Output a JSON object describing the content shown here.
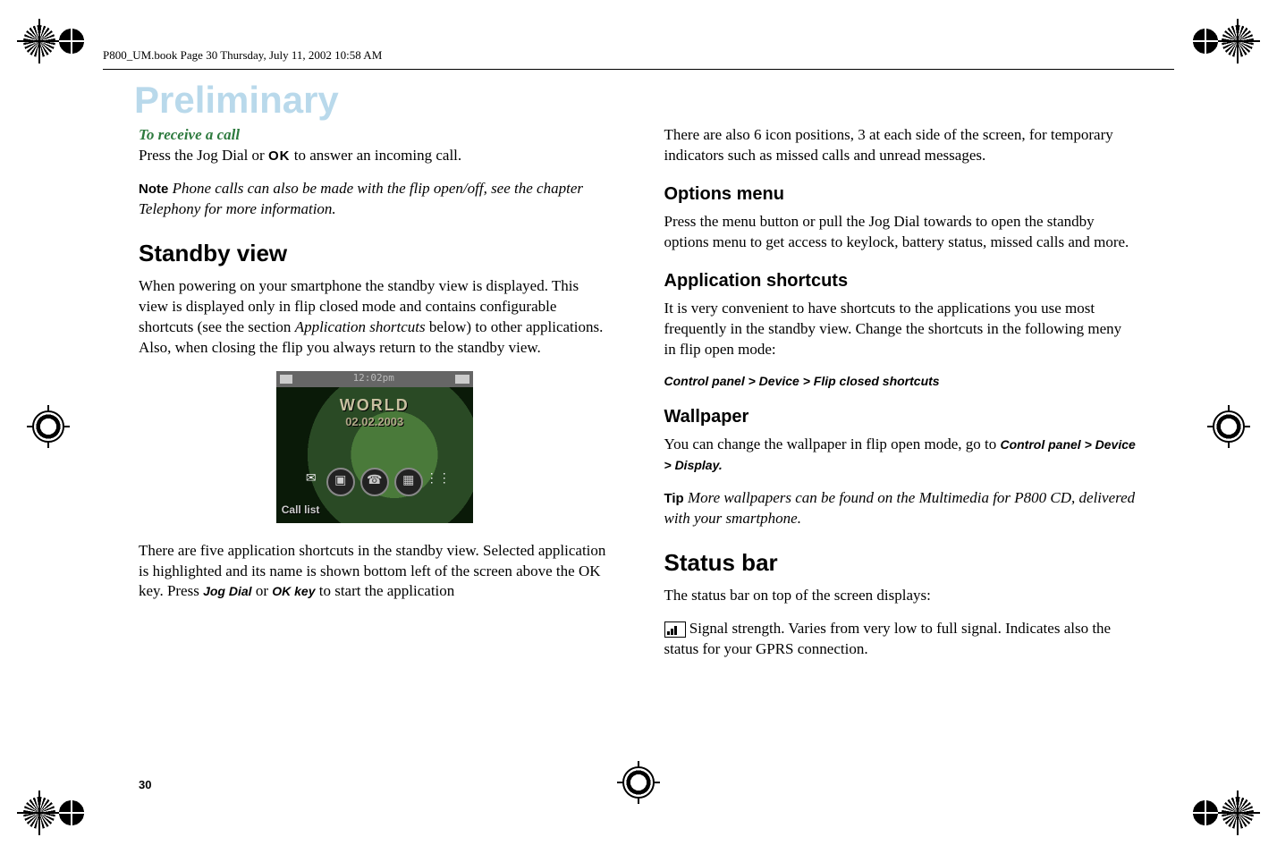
{
  "header": "P800_UM.book  Page 30  Thursday, July 11, 2002  10:58 AM",
  "watermark": "Preliminary",
  "page_number": "30",
  "left": {
    "receive_heading": "To receive a call",
    "receive_prefix": "Press the Jog Dial or ",
    "receive_ok": "OK",
    "receive_suffix": " to answer an incoming call.",
    "note_label": "Note",
    "note_body": " Phone calls can also be made with the flip open/off, see the chapter Telephony for more information.",
    "standby_heading": "Standby view",
    "standby_p1_a": "When powering on your smartphone the standby view is displayed. This view is displayed only in flip closed mode and contains configurable shortcuts (see the section ",
    "standby_p1_em": "Application shortcuts",
    "standby_p1_b": " below) to other applications. Also, when closing the flip you always return to the standby view.",
    "screenshot": {
      "time": "12:02pm",
      "label": "WORLD",
      "date": "02.02.2003",
      "bottom_label": "Call list"
    },
    "shortcuts_p_a": "There are five application shortcuts in the standby view. Selected application is highlighted and its name is shown bottom left of the screen above the OK key. Press ",
    "jog_dial": "Jog Dial",
    "or_word": " or ",
    "ok_key": "OK key",
    "shortcuts_p_c": " to start the application"
  },
  "right": {
    "intro": "There are also 6 icon positions, 3 at each side of the screen, for temporary indicators such as missed calls and unread messages.",
    "options_h": "Options menu",
    "options_p": "Press the menu button or pull the Jog Dial towards to open the standby options menu to get access to keylock, battery status, missed calls and more.",
    "app_h": "Application shortcuts",
    "app_p": "It is very convenient to have shortcuts to the applications you use most frequently in the standby view. Change the shortcuts in the following meny in flip open mode:",
    "app_path": "Control panel > Device > Flip closed shortcuts",
    "wall_h": "Wallpaper",
    "wall_p_a": "You can change the wallpaper in flip open mode, go to ",
    "wall_path": "Control panel > Device > Display.",
    "tip_label": "Tip",
    "tip_body": " More wallpapers can be found on the Multimedia for P800 CD, delivered with your smartphone.",
    "status_h": "Status bar",
    "status_p1": "The status bar on top of the screen displays:",
    "status_p2": " Signal strength. Varies from very low to full signal. Indicates also the status for your GPRS connection."
  },
  "chart_data": {
    "type": "table",
    "title": "Phone standby-view mock screen contents",
    "rows": [
      {
        "field": "time",
        "value": "12:02pm"
      },
      {
        "field": "title",
        "value": "WORLD"
      },
      {
        "field": "date",
        "value": "02.02.2003"
      },
      {
        "field": "caption",
        "value": "Call list"
      },
      {
        "field": "shortcut_count",
        "value": 5
      }
    ]
  }
}
